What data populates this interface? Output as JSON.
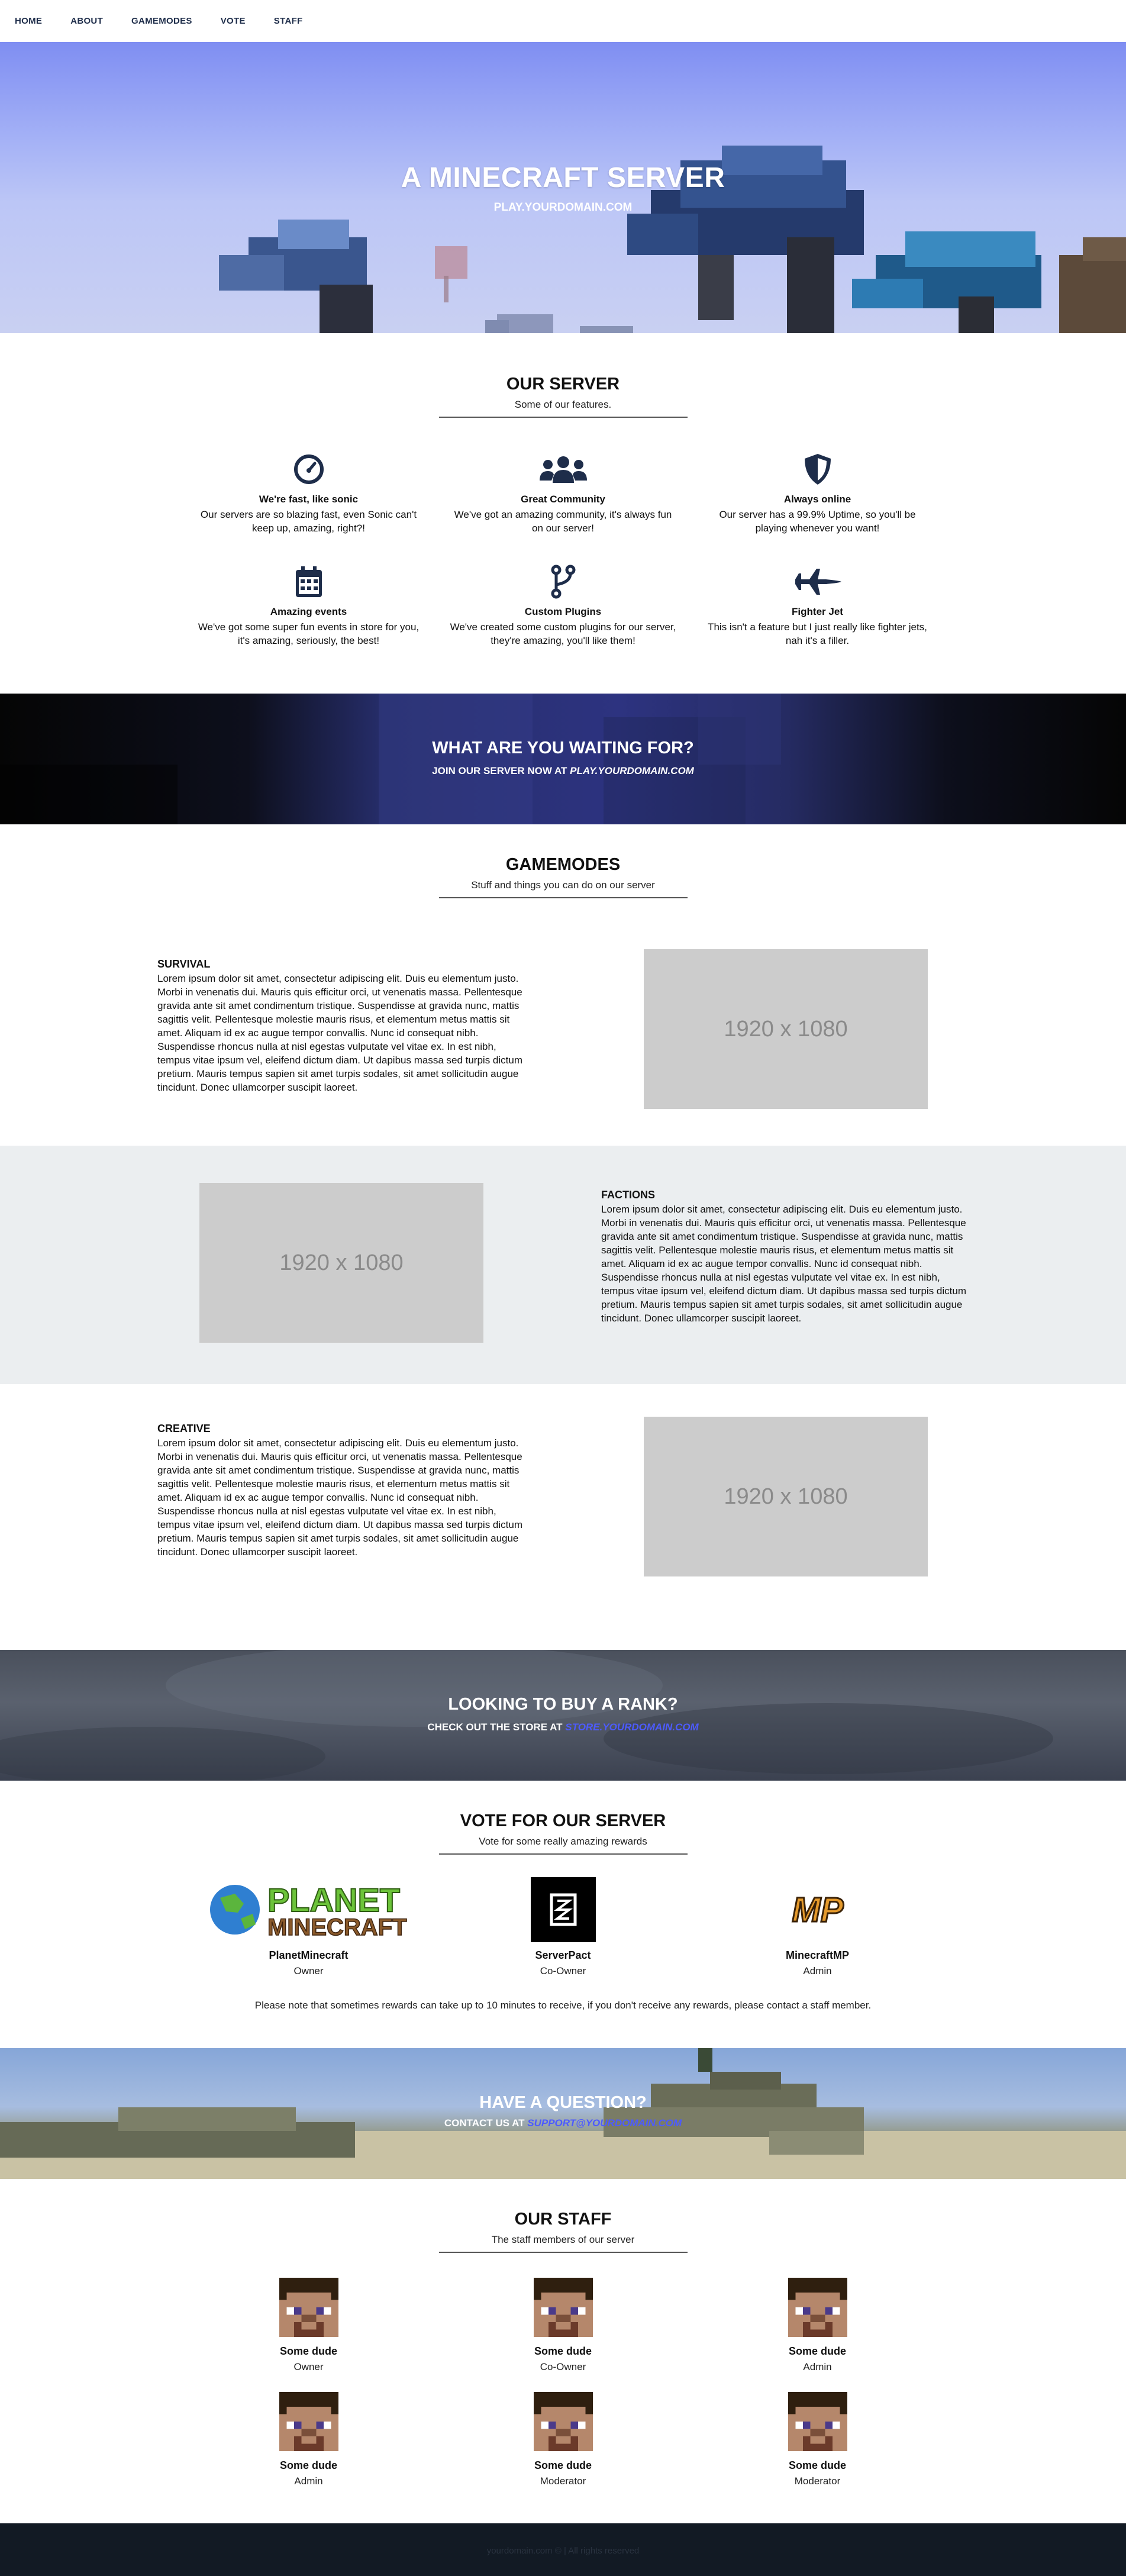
{
  "nav": {
    "items": [
      "HOME",
      "ABOUT",
      "GAMEMODES",
      "VOTE",
      "STAFF"
    ]
  },
  "hero": {
    "title": "A MINECRAFT SERVER",
    "subtitle": "PLAY.YOURDOMAIN.COM"
  },
  "server": {
    "title": "OUR SERVER",
    "subtitle": "Some of our features.",
    "features": [
      {
        "icon": "speedometer-icon",
        "title": "We're fast, like sonic",
        "desc": "Our servers are so blazing fast, even Sonic can't keep up, amazing, right?!"
      },
      {
        "icon": "users-icon",
        "title": "Great Community",
        "desc": "We've got an amazing community, it's always fun on our server!"
      },
      {
        "icon": "shield-icon",
        "title": "Always online",
        "desc": "Our server has a 99.9% Uptime, so you'll be playing whenever you want!"
      },
      {
        "icon": "calendar-icon",
        "title": "Amazing events",
        "desc": "We've got some super fun events in store for you, it's amazing, seriously, the best!"
      },
      {
        "icon": "code-branch-icon",
        "title": "Custom Plugins",
        "desc": "We've created some custom plugins for our server, they're amazing, you'll like them!"
      },
      {
        "icon": "fighter-jet-icon",
        "title": "Fighter Jet",
        "desc": "This isn't a feature but I just really like fighter jets, nah it's a filler."
      }
    ]
  },
  "waiting": {
    "title": "WHAT ARE YOU WAITING FOR?",
    "prefix": "JOIN OUR SERVER NOW AT ",
    "domain": "PLAY.YOURDOMAIN.COM"
  },
  "gamemodes": {
    "title": "GAMEMODES",
    "subtitle": "Stuff and things you can do on our server",
    "placeholder": "1920 x 1080",
    "modes": [
      {
        "name": "SURVIVAL",
        "body": "Lorem ipsum dolor sit amet, consectetur adipiscing elit. Duis eu elementum justo. Morbi in venenatis dui. Mauris quis efficitur orci, ut venenatis massa. Pellentesque gravida ante sit amet condimentum tristique. Suspendisse at gravida nunc, mattis sagittis velit. Pellentesque molestie mauris risus, et elementum metus mattis sit amet. Aliquam id ex ac augue tempor convallis. Nunc id consequat nibh. Suspendisse rhoncus nulla at nisl egestas vulputate vel vitae ex. In est nibh, tempus vitae ipsum vel, eleifend dictum diam. Ut dapibus massa sed turpis dictum pretium. Mauris tempus sapien sit amet turpis sodales, sit amet sollicitudin augue tincidunt. Donec ullamcorper suscipit laoreet."
      },
      {
        "name": "FACTIONS",
        "body": "Lorem ipsum dolor sit amet, consectetur adipiscing elit. Duis eu elementum justo. Morbi in venenatis dui. Mauris quis efficitur orci, ut venenatis massa. Pellentesque gravida ante sit amet condimentum tristique. Suspendisse at gravida nunc, mattis sagittis velit. Pellentesque molestie mauris risus, et elementum metus mattis sit amet. Aliquam id ex ac augue tempor convallis. Nunc id consequat nibh. Suspendisse rhoncus nulla at nisl egestas vulputate vel vitae ex. In est nibh, tempus vitae ipsum vel, eleifend dictum diam. Ut dapibus massa sed turpis dictum pretium. Mauris tempus sapien sit amet turpis sodales, sit amet sollicitudin augue tincidunt. Donec ullamcorper suscipit laoreet."
      },
      {
        "name": "CREATIVE",
        "body": "Lorem ipsum dolor sit amet, consectetur adipiscing elit. Duis eu elementum justo. Morbi in venenatis dui. Mauris quis efficitur orci, ut venenatis massa. Pellentesque gravida ante sit amet condimentum tristique. Suspendisse at gravida nunc, mattis sagittis velit. Pellentesque molestie mauris risus, et elementum metus mattis sit amet. Aliquam id ex ac augue tempor convallis. Nunc id consequat nibh. Suspendisse rhoncus nulla at nisl egestas vulputate vel vitae ex. In est nibh, tempus vitae ipsum vel, eleifend dictum diam. Ut dapibus massa sed turpis dictum pretium. Mauris tempus sapien sit amet turpis sodales, sit amet sollicitudin augue tincidunt. Donec ullamcorper suscipit laoreet."
      }
    ]
  },
  "rank": {
    "title": "LOOKING TO BUY A RANK?",
    "prefix": "CHECK OUT THE STORE AT ",
    "domain": "STORE.YOURDOMAIN.COM"
  },
  "vote": {
    "title": "VOTE FOR OUR SERVER",
    "subtitle": "Vote for some really amazing rewards",
    "sites": [
      {
        "logo": "planet-minecraft-logo",
        "logo_text_1": "PLANET",
        "logo_text_2": "MINECRAFT",
        "name": "PlanetMinecraft",
        "role": "Owner"
      },
      {
        "logo": "serverpact-logo",
        "name": "ServerPact",
        "role": "Co-Owner"
      },
      {
        "logo": "minecraftmp-logo",
        "logo_text": "MP",
        "name": "MinecraftMP",
        "role": "Admin"
      }
    ],
    "note": "Please note that sometimes rewards can take up to 10 minutes to receive, if you don't receive any rewards, please contact a staff member."
  },
  "question": {
    "title": "HAVE A QUESTION?",
    "prefix": "CONTACT US AT ",
    "email": "SUPPORT@YOURDOMAIN.COM"
  },
  "staff": {
    "title": "OUR STAFF",
    "subtitle": "The staff members of our server",
    "members": [
      {
        "name": "Some dude",
        "role": "Owner"
      },
      {
        "name": "Some dude",
        "role": "Co-Owner"
      },
      {
        "name": "Some dude",
        "role": "Admin"
      },
      {
        "name": "Some dude",
        "role": "Admin"
      },
      {
        "name": "Some dude",
        "role": "Moderator"
      },
      {
        "name": "Some dude",
        "role": "Moderator"
      }
    ]
  },
  "footer": {
    "text": "yourdomain.com © | All rights reserved"
  },
  "colors": {
    "nav_text": "#1e2d4a",
    "link_blue": "#4d5bff",
    "footer_bg": "#121a24",
    "alt_row_bg": "#ebeef0"
  }
}
